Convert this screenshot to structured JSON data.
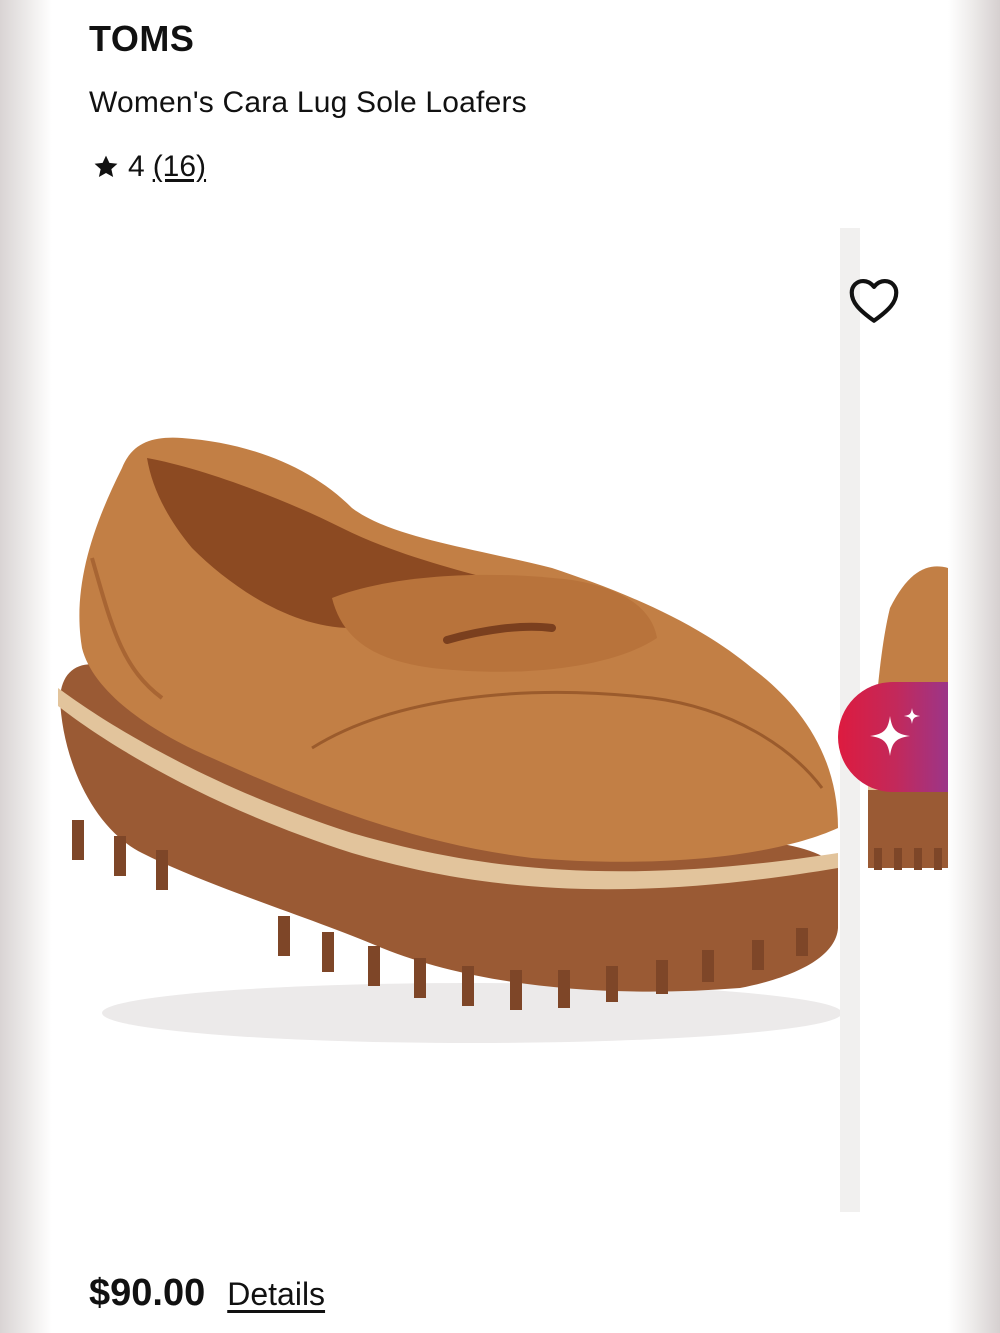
{
  "product": {
    "brand": "TOMS",
    "name": "Women's Cara Lug Sole Loafers",
    "rating": "4",
    "review_count": "(16)",
    "price": "$90.00",
    "details_label": "Details"
  },
  "gallery": {
    "main_image_alt": "",
    "wishlist_icon": "heart-outline-icon",
    "ai_icon": "sparkle-icon"
  },
  "colors": {
    "shoe_leather": "#c27f45",
    "shoe_sole": "#9a5a34",
    "ai_gradient_start": "#dd1b3f",
    "ai_gradient_end": "#8d3a9a"
  }
}
